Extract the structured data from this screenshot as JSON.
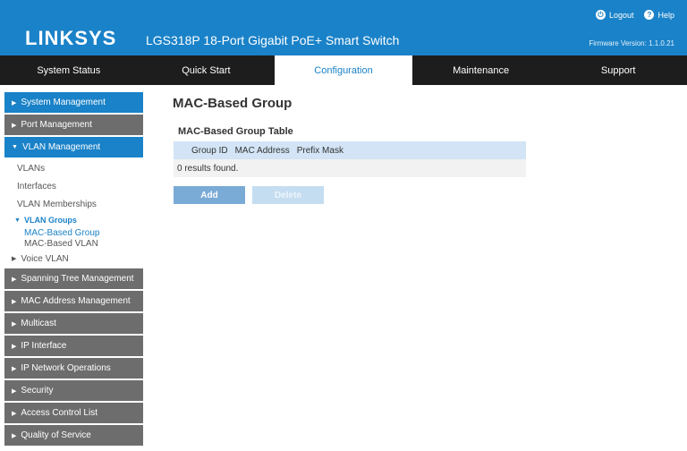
{
  "header": {
    "brand": "LINKSYS",
    "product_name": "LGS318P 18-Port Gigabit PoE+ Smart Switch",
    "logout_label": "Logout",
    "help_label": "Help",
    "firmware": "Firmware Version: 1.1.0.21"
  },
  "tabs": [
    {
      "label": "System Status"
    },
    {
      "label": "Quick Start"
    },
    {
      "label": "Configuration"
    },
    {
      "label": "Maintenance"
    },
    {
      "label": "Support"
    }
  ],
  "active_tab": "Configuration",
  "sidebar": {
    "system_management": "System Management",
    "port_management": "Port Management",
    "vlan_management": "VLAN Management",
    "vlans": "VLANs",
    "interfaces": "Interfaces",
    "vlan_memberships": "VLAN Memberships",
    "vlan_groups": "VLAN Groups",
    "mac_based_group": "MAC-Based Group",
    "mac_based_vlan": "MAC-Based VLAN",
    "voice_vlan": "Voice VLAN",
    "spanning_tree": "Spanning Tree Management",
    "mac_address_management": "MAC Address Management",
    "multicast": "Multicast",
    "ip_interface": "IP Interface",
    "ip_network_operations": "IP Network Operations",
    "security": "Security",
    "access_control_list": "Access Control List",
    "quality_of_service": "Quality of Service"
  },
  "main": {
    "title": "MAC-Based Group",
    "table_title": "MAC-Based Group Table",
    "columns": [
      "Group ID",
      "MAC Address",
      "Prefix Mask"
    ],
    "empty_text": "0 results found.",
    "add_label": "Add",
    "delete_label": "Delete"
  },
  "colors": {
    "brand_blue": "#1a82c8",
    "nav_bg": "#1d1d1d",
    "sidebar_gray": "#6d6d6d"
  }
}
